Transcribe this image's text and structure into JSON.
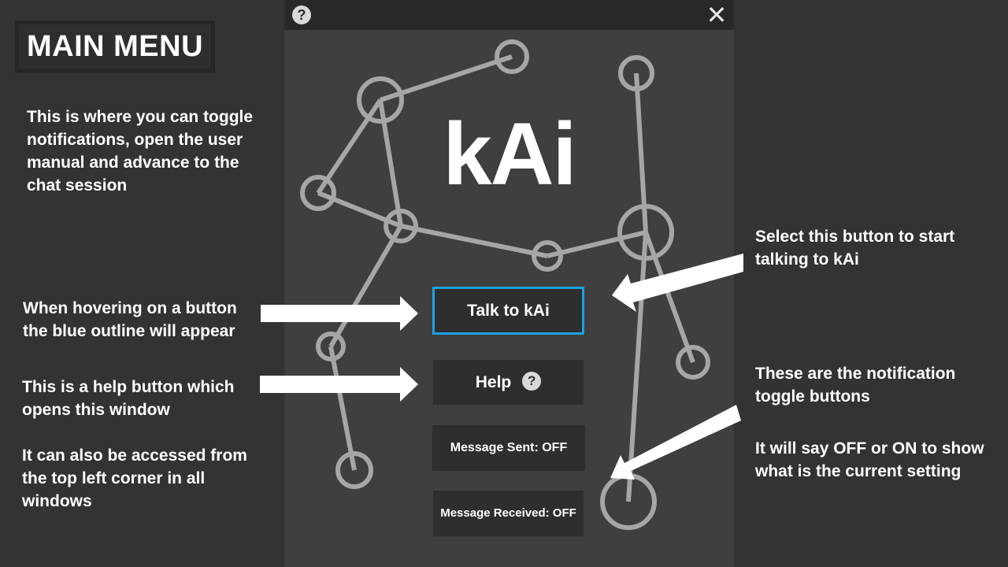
{
  "slide": {
    "title": "MAIN MENU",
    "notes": {
      "intro": "This is where you can toggle notifications, open the user manual and advance to the chat session",
      "hover": "When hovering on a button the blue outline will appear",
      "help": "This is a help button which opens this window",
      "help_access": "It can also be accessed from the top left corner in all windows",
      "talk": "Select this button to start talking to kAi",
      "toggles": "These are the notification toggle buttons",
      "toggle_state": "It will say OFF or ON to show what is the current setting"
    }
  },
  "app": {
    "logo": "kAi",
    "help_icon_glyph": "?",
    "close_icon_glyph": "✕",
    "buttons": {
      "talk": "Talk to kAi",
      "help": "Help",
      "help_glyph": "?",
      "message_sent": "Message Sent: OFF",
      "message_received": "Message Received: OFF"
    }
  },
  "colors": {
    "background": "#333333",
    "window": "#3f3f3f",
    "titlebar": "#282828",
    "button": "#2e2e2e",
    "hover_outline": "#1ba1e2",
    "network_lines": "#a6a6a6"
  },
  "icons": [
    "help-icon",
    "close-icon",
    "question-circle-icon",
    "arrow-right-icon",
    "arrow-left-icon"
  ]
}
